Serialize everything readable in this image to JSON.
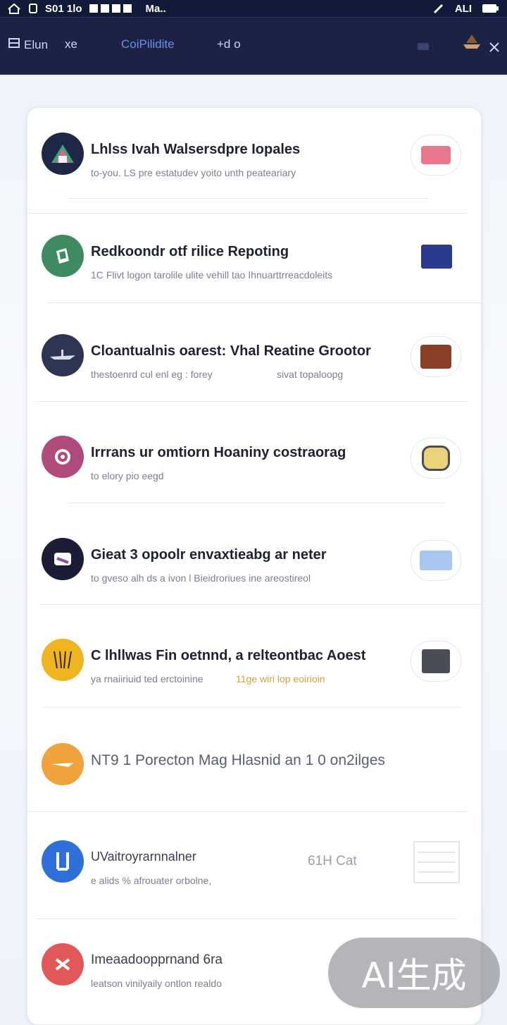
{
  "statusbar": {
    "left_text": "S01 1lo",
    "left_text2": "Ma..",
    "right_text": "ALI"
  },
  "navbar": {
    "items": [
      {
        "label": "Elun",
        "icon": "panel-icon"
      },
      {
        "label": "xe"
      },
      {
        "label": "CoiPilidite"
      },
      {
        "label": "+d o"
      }
    ],
    "icons": [
      "chat-icon",
      "ship-icon",
      "close-icon"
    ]
  },
  "list": {
    "items": [
      {
        "title": "Lhlss Ivah Walsersdpre Iopales",
        "subtitle": "to-you. LS  pre estatudev yoito  unth peateariary",
        "avatar_color": "#1f2747",
        "thumb_color": "#e9778b"
      },
      {
        "title": "Redkoondr otf rilice Repoting",
        "subtitle": "1C  Flivt logon tarolile ulite  vehill tao Ihnuarttrreacdoleits",
        "avatar_color": "#3f8a5f",
        "thumb_color": "#2b3a8c"
      },
      {
        "title": "Cloantualnis oarest: Vhal Reatine Grootor",
        "subtitle": "thestoenrd cul enl eg : forey",
        "subtitle2": "sivat topaloopg",
        "avatar_color": "#2e3552",
        "thumb_color": "#8a3e26"
      },
      {
        "title": "Irrrans ur omtiorn Hoaniny costraorag",
        "subtitle": "to elory pio eegd",
        "avatar_color": "#b04a7c",
        "thumb_color": "#e9d27a"
      },
      {
        "title": "Gieat 3 opoolr envaxtieabg ar neter",
        "subtitle": "to gveso alh ds a  ivon  l Bieidroriues  ine  areostireol",
        "avatar_color": "#1a1d35",
        "thumb_color": "#a9c6f1"
      },
      {
        "title": "C lhllwas Fin oetnnd, a relteontbac Aoest",
        "subtitle": "ya rnaiiriuid ted erctoinine",
        "subtitle2": "11ge wiri lop eoirioin",
        "avatar_color": "#efb420",
        "thumb_color": "#4a4d55"
      },
      {
        "title": "NT9 1 Porecton Mag Hlasnid an 1 0 on2ilges",
        "subtitle": "",
        "avatar_color": "#f0a23c",
        "thumb_color": "#ffffff"
      },
      {
        "title": "UVaitroyrarnnalner",
        "subtitle": "e alids % afrouater orbolne,",
        "side_text": "61H Cat",
        "avatar_color": "#2e6fd9",
        "thumb_color": "#ffffff"
      },
      {
        "title": "Imeaadoopprnand 6ra",
        "subtitle": "leatson vinilyaily ontlon  realdo",
        "avatar_color": "#e25858",
        "thumb_color": "#ffffff"
      }
    ]
  },
  "watermark": "AI生成"
}
